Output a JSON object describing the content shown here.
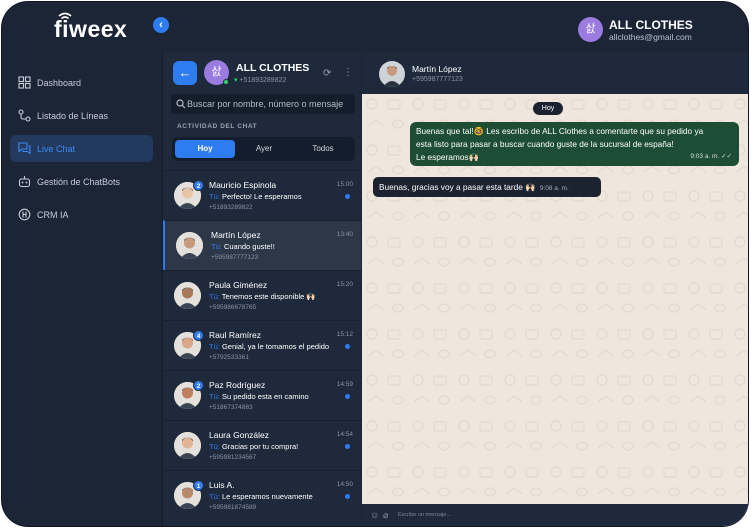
{
  "app": {
    "logo": "fiweex",
    "account_name": "ALL CLOTHES",
    "account_email": "allclothes@gmail.com",
    "account_avatar": "삸"
  },
  "sidebar": {
    "items": [
      {
        "label": "Dashboard",
        "icon": "dashboard-icon"
      },
      {
        "label": "Listado de Líneas",
        "icon": "lines-icon"
      },
      {
        "label": "Live Chat",
        "icon": "chat-icon",
        "active": true
      },
      {
        "label": "Gestión de ChatBots",
        "icon": "bot-icon"
      },
      {
        "label": "CRM IA",
        "icon": "crm-icon"
      }
    ]
  },
  "line": {
    "name": "ALL CLOTHES",
    "phone": "+51893289822",
    "avatar": "삸"
  },
  "search": {
    "placeholder": "Buscar por nombre, número o mensaje"
  },
  "activity": {
    "label": "ACTIVIDAD DEL CHAT",
    "filters": [
      "Hoy",
      "Ayer",
      "Todos"
    ],
    "active_filter": "Hoy"
  },
  "chats": [
    {
      "name": "Mauricio Espinola",
      "prefix": "Tú:",
      "message": "Perfecto! Le esperamos",
      "phone": "+51893289822",
      "time": "15:00",
      "badge": "2",
      "unread": true
    },
    {
      "name": "Martín López",
      "prefix": "Tú:",
      "message": "Cuando guste!!",
      "phone": "+595987777123",
      "time": "13:40",
      "badge": "",
      "unread": false,
      "selected": true
    },
    {
      "name": "Paula Giménez",
      "prefix": "Tú:",
      "message": "Tenemos este disponible 🙌🏻",
      "phone": "+595986678765",
      "time": "15:20",
      "badge": "",
      "unread": false
    },
    {
      "name": "Raul Ramírez",
      "prefix": "Tú:",
      "message": "Genial, ya le tomamos el pedido",
      "phone": "+5792533361",
      "time": "15:12",
      "badge": "4",
      "unread": true
    },
    {
      "name": "Paz Rodríguez",
      "prefix": "Tú:",
      "message": "Su pedido esta en camino",
      "phone": "+51867374883",
      "time": "14:59",
      "badge": "2",
      "unread": true
    },
    {
      "name": "Laura González",
      "prefix": "Tú:",
      "message": "Gracias por tu compra!",
      "phone": "+595981234567",
      "time": "14:54",
      "badge": "",
      "unread": true
    },
    {
      "name": "Luis A.",
      "prefix": "Tú:",
      "message": "Le esperamos nuevamente",
      "phone": "+595981874589",
      "time": "14:50",
      "badge": "1",
      "unread": true
    }
  ],
  "conversation": {
    "contact_name": "Martín López",
    "contact_phone": "+595987777123",
    "day_label": "Hoy",
    "messages": [
      {
        "direction": "out",
        "lines": [
          "Buenas que tal!🤓 Les escribo de ALL Clothes a comentarte que su pedido ya",
          "esta listo para pasar a buscar cuando guste de la sucursal de españa!",
          "Le esperamos🙌🏻"
        ],
        "time": "9:03 a. m.",
        "status": "✓✓"
      },
      {
        "direction": "in",
        "text": "Buenas, gracias voy a pasar esta tarde 🙌🏻",
        "time": "9:08 a. m."
      }
    ],
    "composer_placeholder": "Escribe un mensaje..."
  },
  "colors": {
    "accent": "#2f7bf0",
    "background": "#1b2536",
    "panel": "#1e2a3c",
    "outgoing_bubble": "#1e4d36",
    "online": "#2bd46a"
  }
}
